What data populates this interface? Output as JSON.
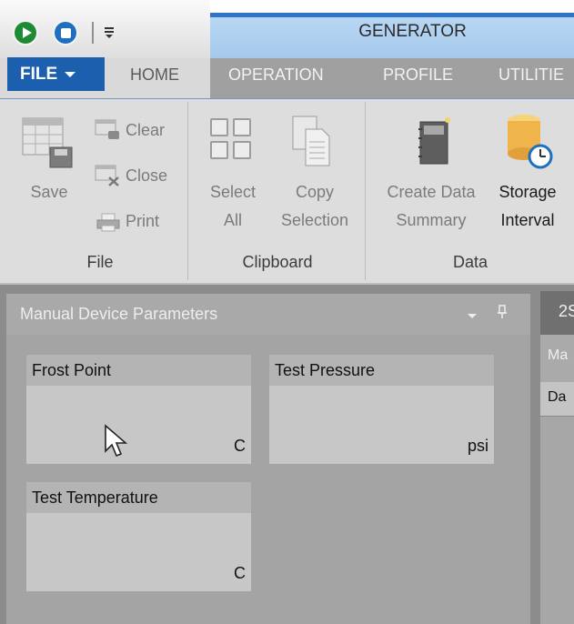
{
  "quick_access": {
    "start_icon": "play-circle-icon",
    "stop_icon": "stop-circle-icon",
    "menu_glyph": "⩸"
  },
  "window": {
    "title": "GENERATOR"
  },
  "tabs": {
    "file": "FILE",
    "home": "HOME",
    "operation": "OPERATION",
    "profile": "PROFILE",
    "utilities": "UTILITIE"
  },
  "ribbon": {
    "file_group": {
      "label": "File",
      "save": "Save",
      "clear": "Clear",
      "close": "Close",
      "print": "Print"
    },
    "clipboard_group": {
      "label": "Clipboard",
      "select_line1": "Select",
      "select_line2": "All",
      "copy_line1": "Copy",
      "copy_line2": "Selection"
    },
    "data_group": {
      "label": "Data",
      "create_line1": "Create Data",
      "create_line2": "Summary",
      "storage_line1": "Storage",
      "storage_line2": "Interval"
    }
  },
  "panel": {
    "title": "Manual Device Parameters",
    "pin_glyph": "⊥",
    "cards": [
      {
        "label": "Frost Point",
        "unit": "C"
      },
      {
        "label": "Test Pressure",
        "unit": "psi"
      },
      {
        "label": "Test Temperature",
        "unit": "C"
      }
    ]
  },
  "right_doc": {
    "tab": "2S",
    "row1": "Ma",
    "row2": "Da"
  },
  "colors": {
    "file_tab": "#1c5fae",
    "banner_top": "#2f74c8",
    "start_green": "#1f8a35",
    "stop_blue": "#1f6fc0"
  }
}
